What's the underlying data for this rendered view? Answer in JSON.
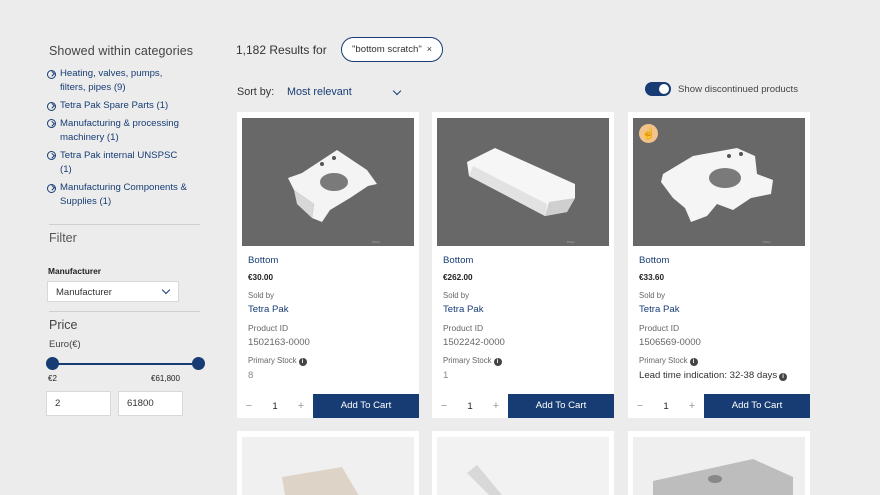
{
  "sidebar": {
    "categories_title": "Showed within categories",
    "categories": [
      {
        "label": "Heating, valves, pumps, filters, pipes (9)"
      },
      {
        "label": "Tetra Pak Spare Parts (1)"
      },
      {
        "label": "Manufacturing & processing machinery (1)"
      },
      {
        "label": "Tetra Pak internal UNSPSC (1)"
      },
      {
        "label": "Manufacturing Components & Supplies (1)"
      }
    ],
    "filter_title": "Filter",
    "manufacturer_label": "Manufacturer",
    "manufacturer_select": "Manufacturer",
    "price_title": "Price",
    "currency_label": "Euro(€)",
    "price_min_label": "€2",
    "price_max_label": "€61,800",
    "price_min_value": "2",
    "price_max_value": "61800",
    "slider_min_fraction": 0,
    "slider_max_fraction": 1
  },
  "results": {
    "count_text": "1,182 Results for",
    "query_chip": "\"bottom scratch\"",
    "chip_close": "×",
    "sort_label": "Sort by:",
    "sort_value": "Most relevant",
    "show_discontinued_label": "Show discontinued products",
    "show_discontinued_on": true
  },
  "products": [
    {
      "name": "Bottom",
      "price": "€30.00",
      "sold_by_label": "Sold by",
      "seller": "Tetra Pak",
      "product_id_label": "Product ID",
      "product_id": "1502163-0000",
      "stock_label": "Primary Stock",
      "stock_value": "8",
      "quantity": "1",
      "qty_minus": "−",
      "qty_plus": "+",
      "add_to_cart": "Add To Cart"
    },
    {
      "name": "Bottom",
      "price": "€262.00",
      "sold_by_label": "Sold by",
      "seller": "Tetra Pak",
      "product_id_label": "Product ID",
      "product_id": "1502242-0000",
      "stock_label": "Primary Stock",
      "stock_value": "1",
      "quantity": "1",
      "qty_minus": "−",
      "qty_plus": "+",
      "add_to_cart": "Add To Cart"
    },
    {
      "name": "Bottom",
      "price": "€33.60",
      "sold_by_label": "Sold by",
      "seller": "Tetra Pak",
      "product_id_label": "Product ID",
      "product_id": "1506569-0000",
      "stock_label": "Primary Stock",
      "stock_value": "Lead time indication: 32-38 days",
      "quantity": "1",
      "qty_minus": "−",
      "qty_plus": "+",
      "add_to_cart": "Add To Cart"
    }
  ],
  "colors": {
    "brand_navy": "#173c74",
    "page_bg": "#ececec",
    "badge": "#f2c38a"
  },
  "icons": {
    "category_bullet": "check-circle-icon",
    "info": "info-icon",
    "badge": "hand-icon",
    "dropdown": "chevron-down-icon"
  }
}
